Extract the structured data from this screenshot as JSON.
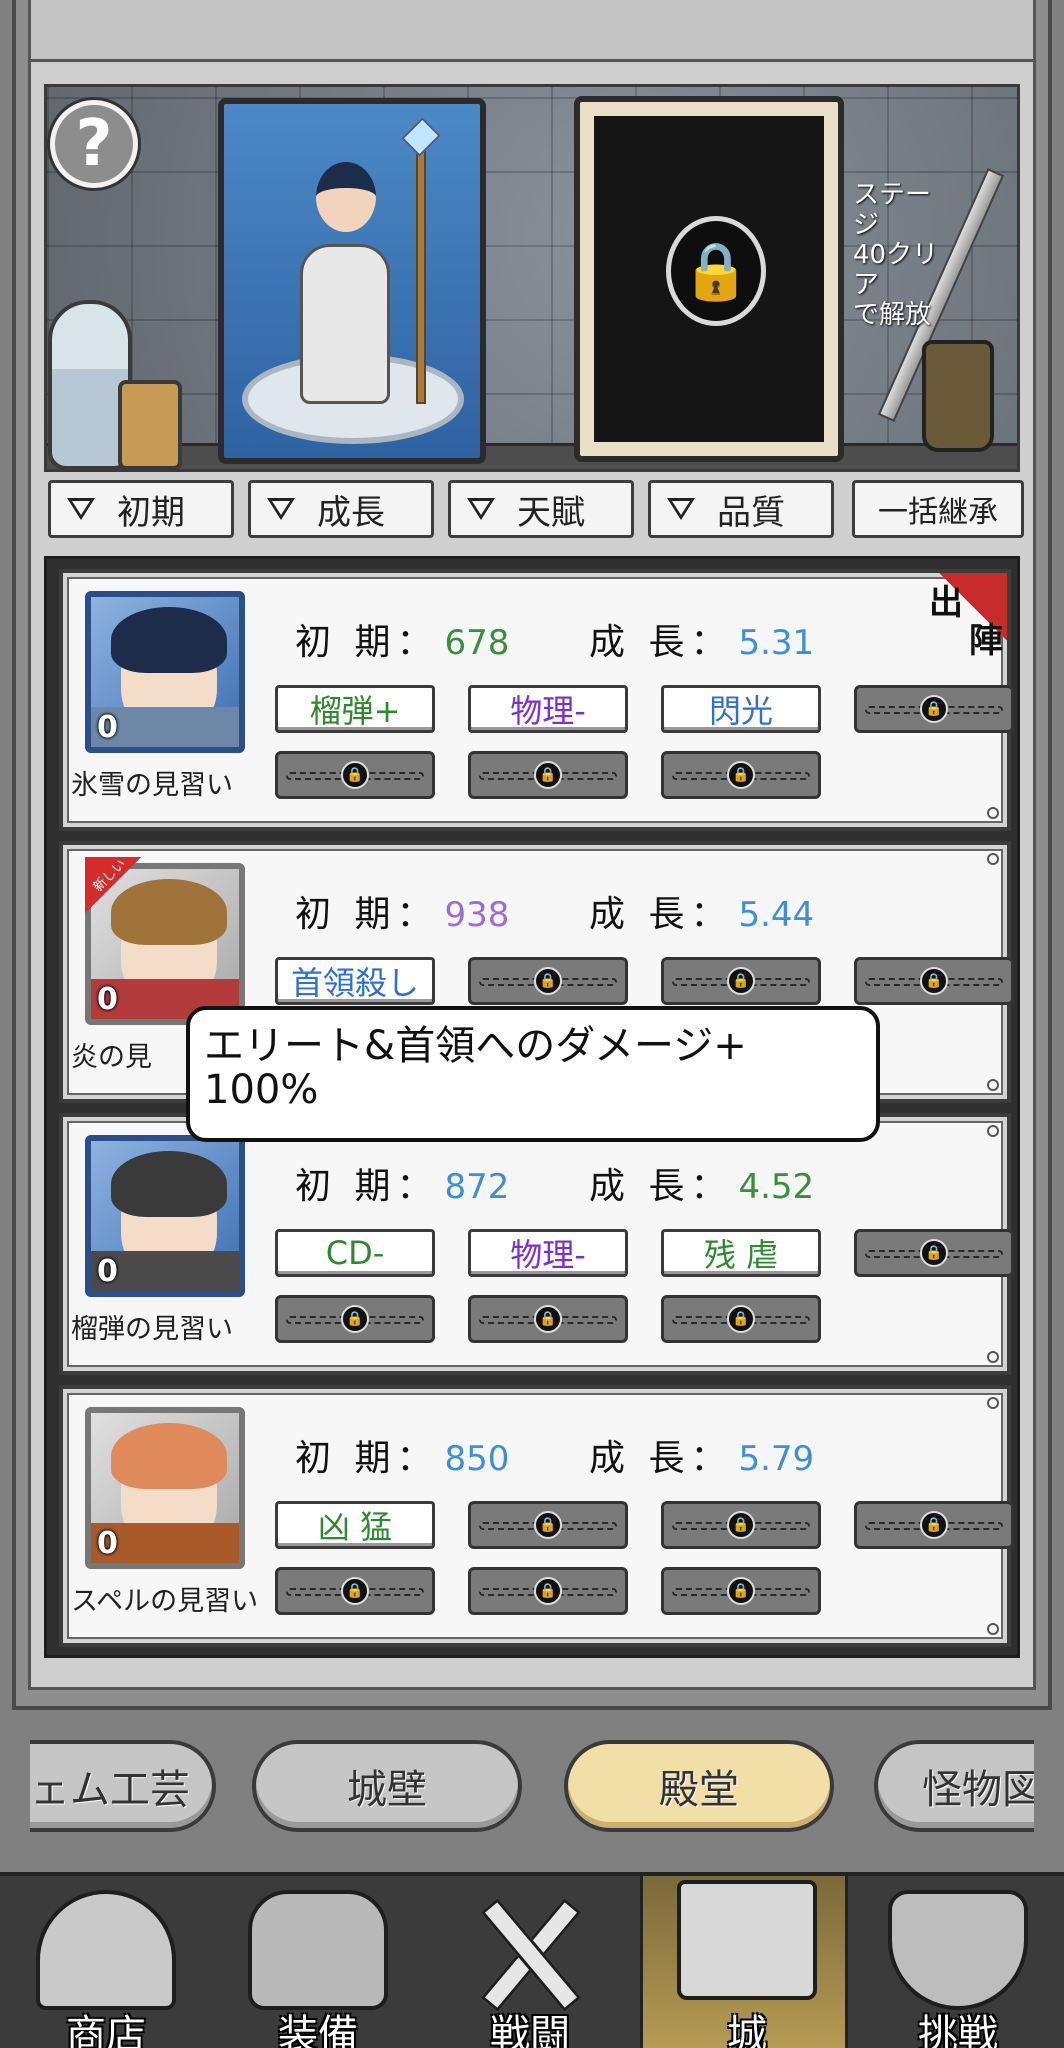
{
  "header": {
    "help_label": "?",
    "unlock_text": [
      "ステージ",
      "40クリア",
      "で解放"
    ]
  },
  "filters": [
    {
      "label": "初期"
    },
    {
      "label": "成長"
    },
    {
      "label": "天賦"
    },
    {
      "label": "品質"
    }
  ],
  "bulk_inherit_label": "一括継承",
  "stat_labels": {
    "initial": "初 期：",
    "growth": "成 長："
  },
  "deploy_badge": [
    "出",
    "陣"
  ],
  "new_badge": "新しい",
  "heroes": [
    {
      "name": "氷雪の見習い",
      "count": "0",
      "initial": "678",
      "initial_color": "#3a8f3a",
      "growth": "5.31",
      "growth_color": "#3e8fd8",
      "traits": [
        {
          "label": "榴弾+",
          "color": "#2f8a2f"
        },
        {
          "label": "物理-",
          "color": "#7a2fd8"
        },
        {
          "label": "閃光",
          "color": "#2f6fd8"
        }
      ]
    },
    {
      "name": "炎の見習い",
      "visible_name": "炎の見",
      "count": "0",
      "initial": "938",
      "initial_color": "#a06ad8",
      "growth": "5.44",
      "growth_color": "#3e8fd8",
      "traits": [
        {
          "label": "首領殺し",
          "color": "#2f6fd8"
        }
      ]
    },
    {
      "name": "榴弾の見習い",
      "count": "0",
      "initial": "872",
      "initial_color": "#3e8fd8",
      "growth": "4.52",
      "growth_color": "#3a8f3a",
      "traits": [
        {
          "label": "CD-",
          "color": "#2f8a2f"
        },
        {
          "label": "物理-",
          "color": "#7a2fd8"
        },
        {
          "label": "残 虐",
          "color": "#2f8a2f"
        }
      ]
    },
    {
      "name": "スペルの見習い",
      "count": "0",
      "initial": "850",
      "initial_color": "#3e8fd8",
      "growth": "5.79",
      "growth_color": "#3e8fd8",
      "traits": [
        {
          "label": "凶 猛",
          "color": "#2f8a2f"
        }
      ]
    }
  ],
  "tooltip": {
    "line1": "エリート&首領へのダメージ+",
    "line2": "100%"
  },
  "tabs": [
    {
      "label": "ェム工芸"
    },
    {
      "label": "城壁"
    },
    {
      "label": "殿堂",
      "active": true
    },
    {
      "label": "怪物図"
    }
  ],
  "nav": [
    {
      "label": "商店",
      "icon": "shop-icon"
    },
    {
      "label": "装備",
      "icon": "backpack-icon"
    },
    {
      "label": "戦闘",
      "icon": "crossed-swords-icon"
    },
    {
      "label": "城",
      "icon": "castle-icon",
      "active": true
    },
    {
      "label": "挑戦",
      "icon": "shield-icon"
    }
  ]
}
